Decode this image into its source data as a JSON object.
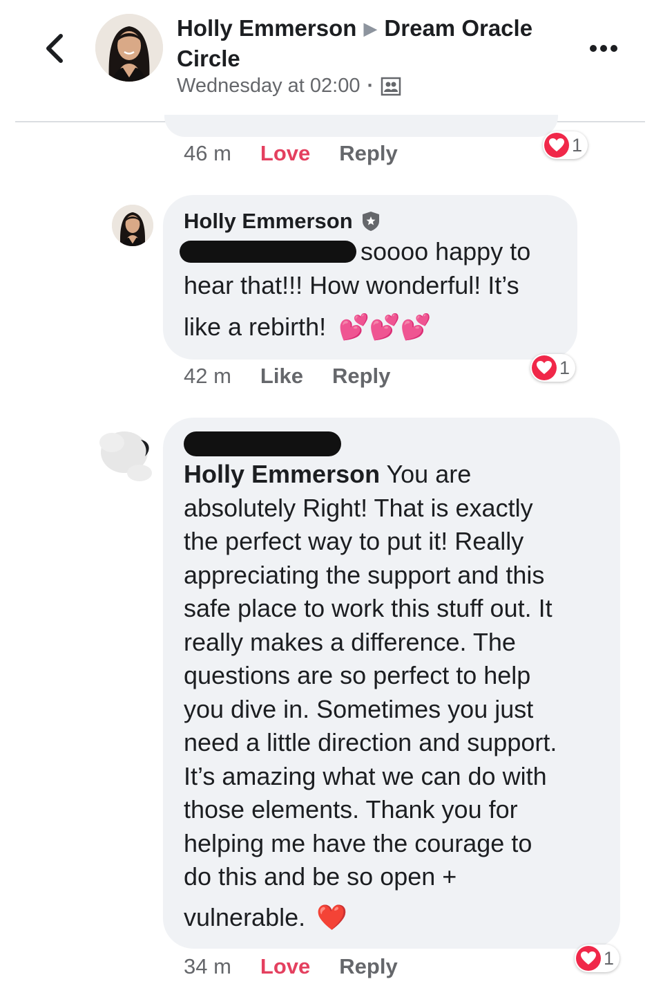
{
  "header": {
    "author": "Holly Emmerson",
    "group": "Dream Oracle Circle",
    "timestamp": "Wednesday at 02:00",
    "icons": {
      "back": "chevron-left-icon",
      "arrow": "triangle-right-icon",
      "privacy": "group-icon",
      "more": "more-horizontal-icon"
    }
  },
  "comments": [
    {
      "time": "46 m",
      "action1": "Love",
      "action2": "Reply",
      "reaction": {
        "icon": "heart-icon",
        "count": "1"
      }
    },
    {
      "author": "Holly Emmerson",
      "author_badge": "admin-shield-icon",
      "line1": "n soooo happy to",
      "line2": "hear that!!! How wonderful! It’s",
      "line3": "like a rebirth!",
      "emojis": "💕💕💕",
      "time": "42 m",
      "action1": "Like",
      "action2": "Reply",
      "reaction": {
        "icon": "heart-icon",
        "count": "1"
      }
    },
    {
      "mention": "Holly Emmerson",
      "lines": [
        "absolutely Right! That is exactly",
        "the perfect way to put it! Really",
        "appreciating the support and this",
        "safe place to work this stuff out. It",
        "really makes a difference. The",
        "questions are so perfect to help",
        "you dive in. Sometimes you just",
        "need a little direction and support.",
        "It’s amazing what we can do with",
        "those elements. Thank you for",
        "helping me have the courage to",
        "do this and be so open +"
      ],
      "first_line_rest": " You are",
      "last_line": "vulnerable.",
      "emoji": "❤️",
      "time": "34 m",
      "action1": "Love",
      "action2": "Reply",
      "reaction": {
        "icon": "heart-icon",
        "count": "1"
      }
    }
  ],
  "colors": {
    "love": "#e4405f",
    "bubble": "#f0f2f5",
    "meta": "#65676b",
    "reaction": "#f02849"
  }
}
